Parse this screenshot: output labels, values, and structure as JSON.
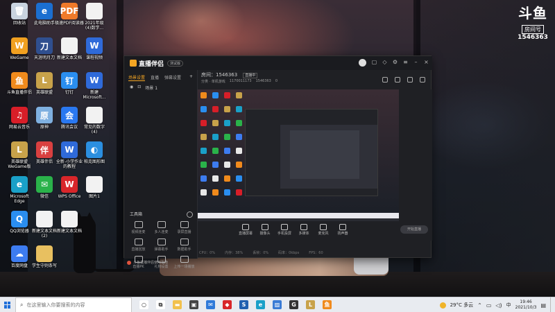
{
  "desktop_icons": [
    {
      "label": "回收站",
      "color": "#c9d3df",
      "glyph": "🗑",
      "name": "recycle-bin-icon"
    },
    {
      "label": "WeGame",
      "color": "#f0a020",
      "glyph": "W",
      "name": "wegame-icon"
    },
    {
      "label": "斗鱼直播伴侣",
      "color": "#f08a1c",
      "glyph": "鱼",
      "name": "douyu-companion-icon"
    },
    {
      "label": "网易云音乐",
      "color": "#d81e28",
      "glyph": "♫",
      "name": "netease-music-icon"
    },
    {
      "label": "英雄联盟\nWeGame版",
      "color": "#c8a24a",
      "glyph": "L",
      "name": "lol-wegame-icon"
    },
    {
      "label": "Microsoft\nEdge",
      "color": "#1aa0c8",
      "glyph": "e",
      "name": "edge-icon"
    },
    {
      "label": "QQ浏览器",
      "color": "#2a8ef0",
      "glyph": "Q",
      "name": "qq-browser-icon"
    },
    {
      "label": "百度网盘",
      "color": "#3d7cf0",
      "glyph": "☁",
      "name": "baidu-netdisk-icon"
    },
    {
      "label": "此电脑助手",
      "color": "#1b6fd0",
      "glyph": "e",
      "name": "ie-icon"
    },
    {
      "label": "天涯明月刀",
      "color": "#2f4f8f",
      "glyph": "刀",
      "name": "tianya-icon"
    },
    {
      "label": "英雄联盟",
      "color": "#c8a24a",
      "glyph": "L",
      "name": "lol-icon"
    },
    {
      "label": "原神",
      "color": "#7fb0e0",
      "glyph": "原",
      "name": "genshin-icon"
    },
    {
      "label": "英雄伴侣",
      "color": "#d94040",
      "glyph": "伴",
      "name": "hero-partner-icon"
    },
    {
      "label": "微信",
      "color": "#2ab24a",
      "glyph": "✉",
      "name": "wechat-icon"
    },
    {
      "label": "新建文本文档\n(2)",
      "color": "#f2f2f2",
      "glyph": "",
      "name": "text-doc-2-icon"
    },
    {
      "label": "学生守则条写",
      "color": "#e8c060",
      "glyph": "",
      "name": "student-doc-icon"
    },
    {
      "label": "极速PDF阅读器",
      "color": "#f07a2a",
      "glyph": "PDF",
      "name": "pdf-reader-icon"
    },
    {
      "label": "新建文本文档",
      "color": "#f2f2f2",
      "glyph": "",
      "name": "text-doc-icon"
    },
    {
      "label": "钉钉",
      "color": "#2a8ef0",
      "glyph": "钉",
      "name": "dingtalk-icon"
    },
    {
      "label": "腾讯会议",
      "color": "#2a78f0",
      "glyph": "会",
      "name": "tencent-meeting-icon"
    },
    {
      "label": "全新-小学作业\n的教程",
      "color": "#2f6ad9",
      "glyph": "W",
      "name": "word-doc-icon"
    },
    {
      "label": "WPS Office",
      "color": "#d8262a",
      "glyph": "W",
      "name": "wps-icon"
    },
    {
      "label": "新建文本文档",
      "color": "#f2f2f2",
      "glyph": "",
      "name": "text-doc-3-icon"
    },
    {
      "label": "2021年级\n(4)数学...",
      "color": "#f2f2f2",
      "glyph": "",
      "name": "math-doc-icon"
    },
    {
      "label": "课程视频",
      "color": "#2f6ad9",
      "glyph": "W",
      "name": "course-video-icon"
    },
    {
      "label": "新建\nMicrosoft...",
      "color": "#2f6ad9",
      "glyph": "W",
      "name": "new-ms-doc-icon"
    },
    {
      "label": "常见的数字\n(4)",
      "color": "#f2f2f2",
      "glyph": "",
      "name": "numbers-doc-icon"
    },
    {
      "label": "帕克图形图",
      "color": "#2b8fe0",
      "glyph": "◐",
      "name": "graphics-icon"
    },
    {
      "label": "图片1",
      "color": "#f2f2f2",
      "glyph": "",
      "name": "picture-1-icon"
    }
  ],
  "douyu": {
    "logo": "斗鱼",
    "room_label": "房间号",
    "room_number": "1546363"
  },
  "app": {
    "title": "直播伴侣",
    "version": "测试版",
    "tabs": [
      "场景设置",
      "直播",
      "弹幕设置"
    ],
    "scene": {
      "eye": "◉",
      "label": "场景 1"
    },
    "room": {
      "label": "房间：1546363",
      "tag": "直播中",
      "category": "分类 · 单机游戏",
      "uid": "1170011173",
      "rid": "1546363",
      "fans": "0"
    },
    "tools_title": "工具箱",
    "tools": [
      "视频连麦",
      "多人连麦",
      "录屏直播",
      "直播回放",
      "弹幕助手",
      "数据助手",
      "直播PK",
      "礼物设置",
      "上传一场播放"
    ],
    "notice": "斗鱼直播伴侣使用指南",
    "controls": [
      "直播屏幕",
      "摄像头",
      "手机投屏",
      "多媒体",
      "麦克风",
      "扬声器"
    ],
    "live_button": "开始直播",
    "status": [
      "CPU：0%",
      "内存：38%",
      "丢帧：0%",
      "码率：0kbps",
      "FPS：60"
    ]
  },
  "taskbar": {
    "search_placeholder": "在这里输入你要搜索的内容",
    "weather": "29°C 多云",
    "time": "19:46",
    "date": "2021/10/3",
    "input_method": "中",
    "icons": [
      {
        "name": "cortana-icon",
        "color": "#ffffff",
        "glyph": "○"
      },
      {
        "name": "task-view-icon",
        "color": "#ffffff",
        "glyph": "⧉"
      },
      {
        "name": "file-explorer-icon",
        "color": "#f2c14e",
        "glyph": "▬"
      },
      {
        "name": "store-icon",
        "color": "#444444",
        "glyph": "▣"
      },
      {
        "name": "mail-icon",
        "color": "#2f7ad9",
        "glyph": "✉"
      },
      {
        "name": "app-red-icon",
        "color": "#d8262a",
        "glyph": "◆"
      },
      {
        "name": "app-s-icon",
        "color": "#2060b0",
        "glyph": "S"
      },
      {
        "name": "edge-taskbar-icon",
        "color": "#1aa0c8",
        "glyph": "e"
      },
      {
        "name": "photos-icon",
        "color": "#3a7bd5",
        "glyph": "▨"
      },
      {
        "name": "app-g-icon",
        "color": "#333333",
        "glyph": "G"
      },
      {
        "name": "lol-taskbar-icon",
        "color": "#c8a24a",
        "glyph": "L"
      },
      {
        "name": "douyu-taskbar-icon",
        "color": "#f08a1c",
        "glyph": "鱼"
      }
    ]
  }
}
